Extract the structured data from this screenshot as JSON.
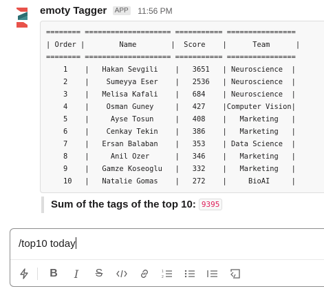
{
  "message": {
    "app_name": "emoty Tagger",
    "app_badge": "APP",
    "timestamp": "11:56 PM",
    "table_text": "======== ==================== =========== ================\n| Order |        Name        |  Score    |      Team      |\n======== ==================== =========== ================\n    1    |   Hakan Sevgili    |   3651   | Neuroscience  |\n    2    |    Sumeyya Eser    |   2536   | Neuroscience  |\n    3    |   Melisa Kafali    |   684    | Neuroscience  |\n    4    |    Osman Guney     |   427    |Computer Vision|\n    5    |     Ayse Tosun     |   408    |   Marketing   |\n    6    |    Cenkay Tekin    |   386    |   Marketing   |\n    7    |   Ersan Balaban    |   353    | Data Science  |\n    8    |     Anil Ozer      |   346    |   Marketing   |\n    9    |   Gamze Koseoglu   |   332    |   Marketing   |\n    10   |   Natalie Gomas    |   272    |     BioAI     |",
    "summary_label": "Sum of the tags of the top 10:",
    "summary_value": "9395"
  },
  "composer": {
    "input_value": "/top10 today",
    "toolbar": [
      "shortcuts-icon",
      "bold-icon",
      "italic-icon",
      "strikethrough-icon",
      "code-icon",
      "link-icon",
      "ordered-list-icon",
      "bulleted-list-icon",
      "blockquote-icon",
      "code-block-icon"
    ]
  },
  "colors": {
    "accent_inline_code": "#e01e5a",
    "logo_red": "#e8524a",
    "logo_teal": "#2c6e72"
  }
}
